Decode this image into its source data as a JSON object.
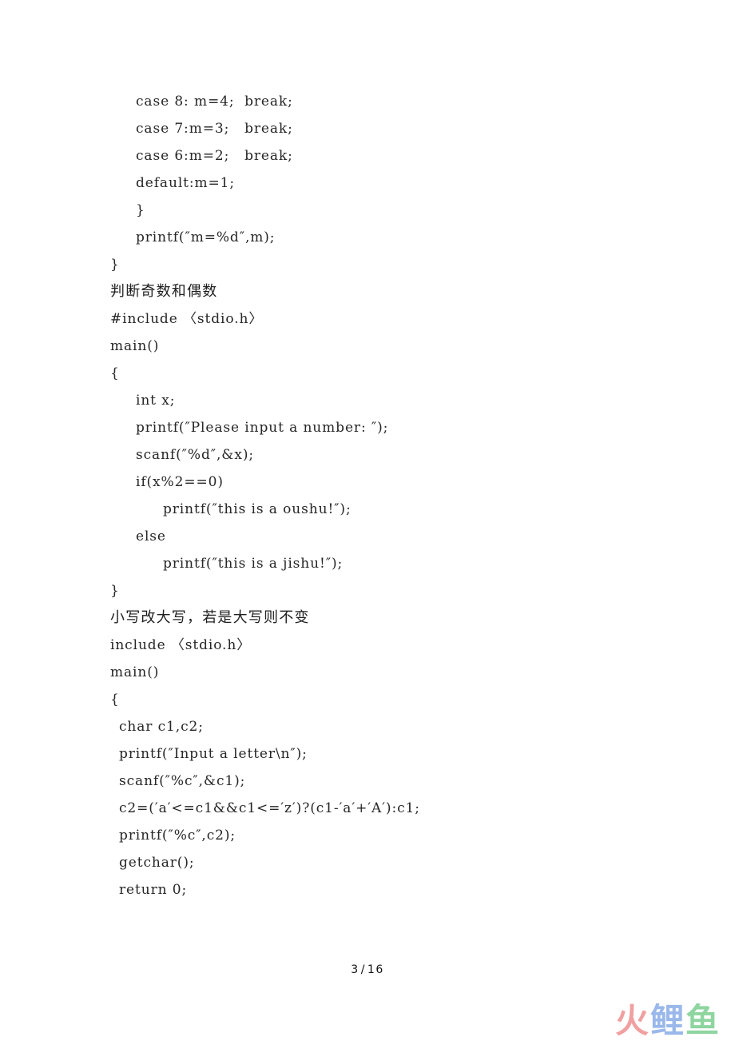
{
  "document": {
    "page_label": "3",
    "page_separator": "/",
    "page_total": "16"
  },
  "body_blocks": [
    {
      "type": "code",
      "lines": [
        {
          "indent": "ind1",
          "text": "case 8: m=4;  break;"
        },
        {
          "indent": "ind1",
          "text": "case 7:m=3;   break;"
        },
        {
          "indent": "ind1",
          "text": "case 6:m=2;   break;"
        },
        {
          "indent": "ind1",
          "text": "default:m=1;"
        },
        {
          "indent": "ind1",
          "text": "}"
        },
        {
          "indent": "ind1",
          "text": "printf(″m=%d″,m);"
        },
        {
          "indent": "ind0",
          "text": "}"
        }
      ]
    },
    {
      "type": "heading",
      "text": "判断奇数和偶数"
    },
    {
      "type": "code",
      "lines": [
        {
          "indent": "ind0",
          "text": "#include 〈stdio.h〉"
        },
        {
          "indent": "ind0",
          "text": "main()"
        },
        {
          "indent": "ind0",
          "text": "{"
        },
        {
          "indent": "ind1",
          "text": "int x;"
        },
        {
          "indent": "ind1",
          "text": "printf(″Please input a number: ″);"
        },
        {
          "indent": "ind1",
          "text": "scanf(″%d″,&x);"
        },
        {
          "indent": "ind1",
          "text": "if(x%2==0)"
        },
        {
          "indent": "ind2",
          "text": "printf(″this is a oushu!″);"
        },
        {
          "indent": "ind1",
          "text": "else"
        },
        {
          "indent": "ind2",
          "text": "printf(″this is a jishu!″);"
        },
        {
          "indent": "ind0",
          "text": "}"
        }
      ]
    },
    {
      "type": "heading",
      "text": "小写改大写，若是大写则不变"
    },
    {
      "type": "code",
      "lines": [
        {
          "indent": "ind0",
          "text": "include 〈stdio.h〉"
        },
        {
          "indent": "ind0",
          "text": "main()"
        },
        {
          "indent": "ind0",
          "text": "{"
        },
        {
          "indent": "ind-half",
          "text": "char c1,c2;"
        },
        {
          "indent": "ind-half",
          "text": "printf(″Input a letter\\n″);"
        },
        {
          "indent": "ind-half",
          "text": "scanf(″%c″,&c1);"
        },
        {
          "indent": "ind-half",
          "text": "c2=(′a′<=c1&&c1<=′z′)?(c1-′a′+′A′):c1;"
        },
        {
          "indent": "ind-half",
          "text": "printf(″%c″,c2);"
        },
        {
          "indent": "ind-half",
          "text": "getchar();"
        },
        {
          "indent": "ind-half",
          "text": "return 0;"
        }
      ]
    }
  ],
  "watermark": {
    "characters": [
      {
        "glyph": "火",
        "color": "#f0a0a0"
      },
      {
        "glyph": "鲤",
        "color": "#9ab8ea"
      },
      {
        "glyph": "鱼",
        "color": "#8ed5a0"
      }
    ]
  }
}
